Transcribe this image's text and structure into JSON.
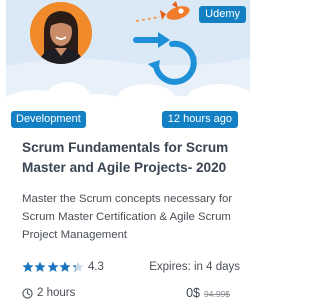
{
  "course": {
    "provider": "Udemy",
    "category": "Development",
    "posted": "12 hours ago",
    "title": "Scrum Fundamentals for Scrum Master and Agile Projects- 2020",
    "description": "Master the Scrum concepts necessary for Scrum Master Certification & Agile Scrum Project Management",
    "rating": {
      "value": "4.3",
      "stars": 4.3,
      "max": 5
    },
    "expires": "Expires: in 4 days",
    "duration": "2 hours",
    "price": "0$",
    "old_price": "94.99$"
  },
  "colors": {
    "badge": "#1380c4",
    "star": "#1a74bf",
    "hero_bg": "#dbe8f6",
    "cycle": "#1e90d8",
    "rocket": "#f07c2b"
  },
  "icons": {
    "star": "star-icon",
    "clock": "clock-icon",
    "rocket": "rocket-icon",
    "cycle": "scrum-cycle-icon"
  }
}
